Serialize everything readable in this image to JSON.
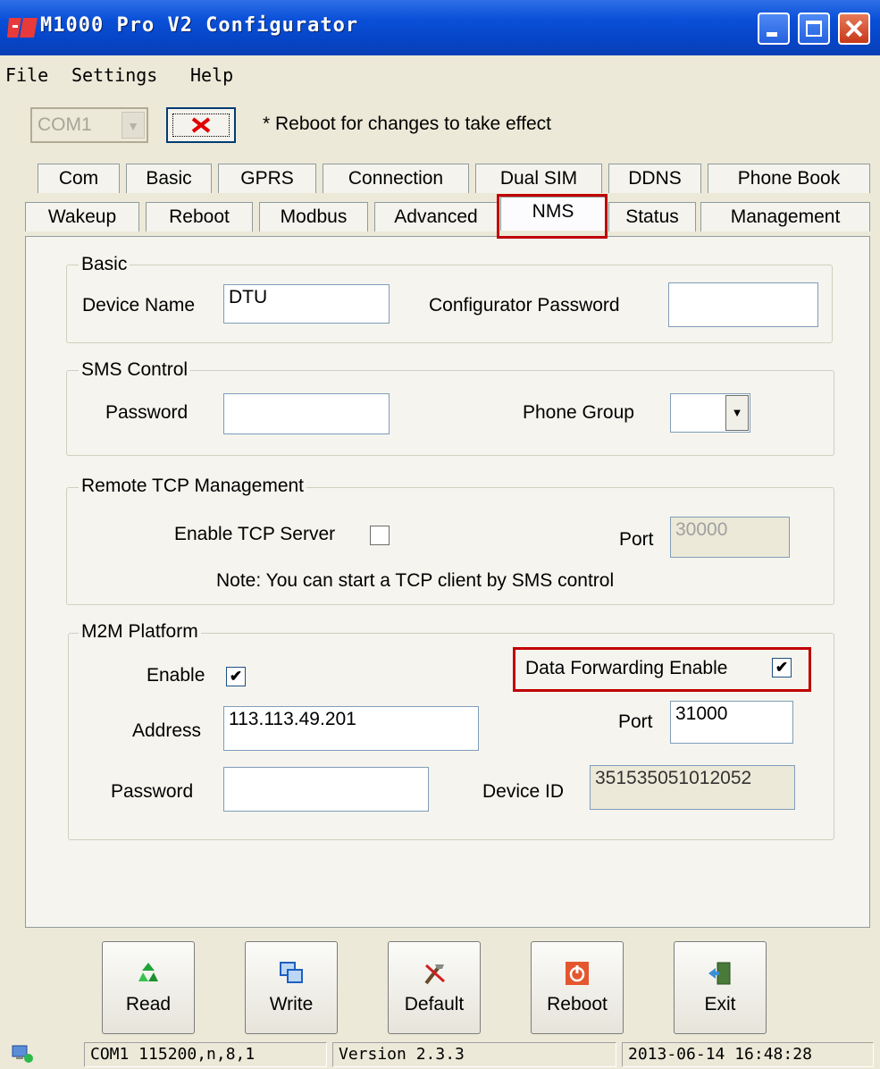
{
  "window": {
    "title": "M1000 Pro V2 Configurator"
  },
  "menu": {
    "items": [
      "File",
      "Settings",
      "Help"
    ]
  },
  "toolbar": {
    "port_value": "COM1",
    "note": "* Reboot for changes to take effect"
  },
  "tabs": {
    "row1": [
      "Com",
      "Basic",
      "GPRS",
      "Connection",
      "Dual SIM",
      "DDNS",
      "Phone Book"
    ],
    "row2": [
      "Wakeup",
      "Reboot",
      "Modbus",
      "Advanced",
      "NMS",
      "Status",
      "Management"
    ],
    "active": "NMS"
  },
  "basic": {
    "legend": "Basic",
    "device_name_label": "Device Name",
    "device_name_value": "DTU",
    "config_password_label": "Configurator Password",
    "config_password_value": ""
  },
  "sms": {
    "legend": "SMS Control",
    "password_label": "Password",
    "password_value": "",
    "phone_group_label": "Phone Group",
    "phone_group_value": ""
  },
  "tcp": {
    "legend": "Remote TCP Management",
    "enable_label": "Enable TCP Server",
    "enable_checked": false,
    "port_label": "Port",
    "port_value": "30000",
    "note": "Note: You can start a TCP client by SMS control"
  },
  "m2m": {
    "legend": "M2M Platform",
    "enable_label": "Enable",
    "enable_checked": true,
    "forwarding_label": "Data Forwarding Enable",
    "forwarding_checked": true,
    "address_label": "Address",
    "address_value": "113.113.49.201",
    "port_label": "Port",
    "port_value": "31000",
    "password_label": "Password",
    "password_value": "",
    "device_id_label": "Device ID",
    "device_id_value": "351535051012052"
  },
  "buttons": {
    "read": "Read",
    "write": "Write",
    "default": "Default",
    "reboot": "Reboot",
    "exit": "Exit"
  },
  "status": {
    "connection": "COM1 115200,n,8,1",
    "version": "Version 2.3.3",
    "datetime": "2013-06-14 16:48:28"
  },
  "colors": {
    "highlight": "#c00000",
    "titlebar": "#0a50d8"
  }
}
